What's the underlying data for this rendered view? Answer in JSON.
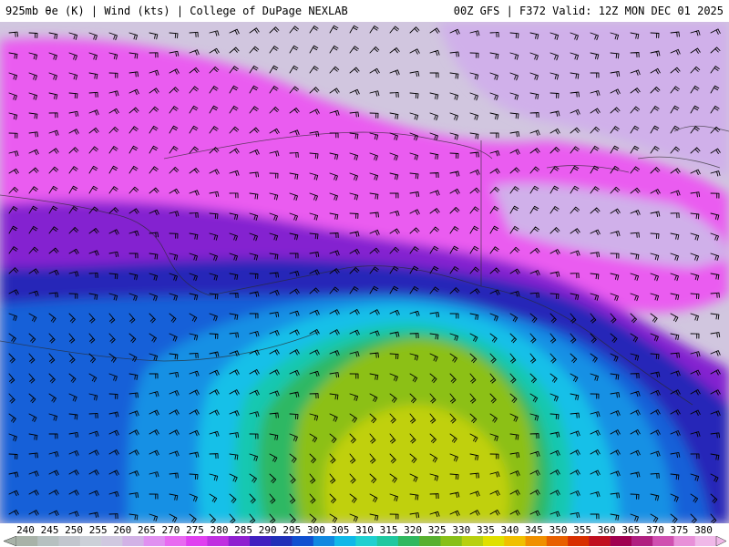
{
  "header": {
    "left_title": "925mb θe (K) | Wind (kts) | College of DuPage NEXLAB",
    "right_title": "00Z GFS | F372 Valid: 12Z MON DEC 01 2025"
  },
  "colorbar": {
    "labels": [
      "240",
      "245",
      "250",
      "255",
      "260",
      "265",
      "270",
      "275",
      "280",
      "285",
      "290",
      "295",
      "300",
      "305",
      "310",
      "315",
      "320",
      "325",
      "330",
      "335",
      "340",
      "345",
      "350",
      "355",
      "360",
      "365",
      "370",
      "375",
      "380"
    ],
    "colors": [
      "#a8b2a8",
      "#b6c0c0",
      "#c2c6ce",
      "#ccd0d8",
      "#d0c8e0",
      "#d2b2e6",
      "#e090f0",
      "#e86af0",
      "#e040f0",
      "#c030e0",
      "#9020d0",
      "#4020c0",
      "#2030b8",
      "#1050d0",
      "#1088e0",
      "#10b8e8",
      "#20d0d0",
      "#20c8a0",
      "#30b860",
      "#58b030",
      "#88c018",
      "#b8d010",
      "#e0e000",
      "#f0c000",
      "#f09000",
      "#e86000",
      "#d83000",
      "#c01020",
      "#a00050",
      "#b02080",
      "#d050b0",
      "#e890d8",
      "#f0b8e8"
    ]
  },
  "map": {
    "background": "#d1c6df",
    "contour_colors": {
      "region_pink": "#ea5cf0",
      "region_lavender": "#d0b0ea",
      "region_purple": "#8420d0",
      "region_navy": "#2828b8",
      "region_blue": "#1660d8",
      "region_sky": "#1890e4",
      "region_cyan": "#18c0e8",
      "region_teal": "#18c8b0",
      "region_green": "#2eb864",
      "region_lime": "#8cc018",
      "region_yellow": "#c0d010"
    }
  }
}
